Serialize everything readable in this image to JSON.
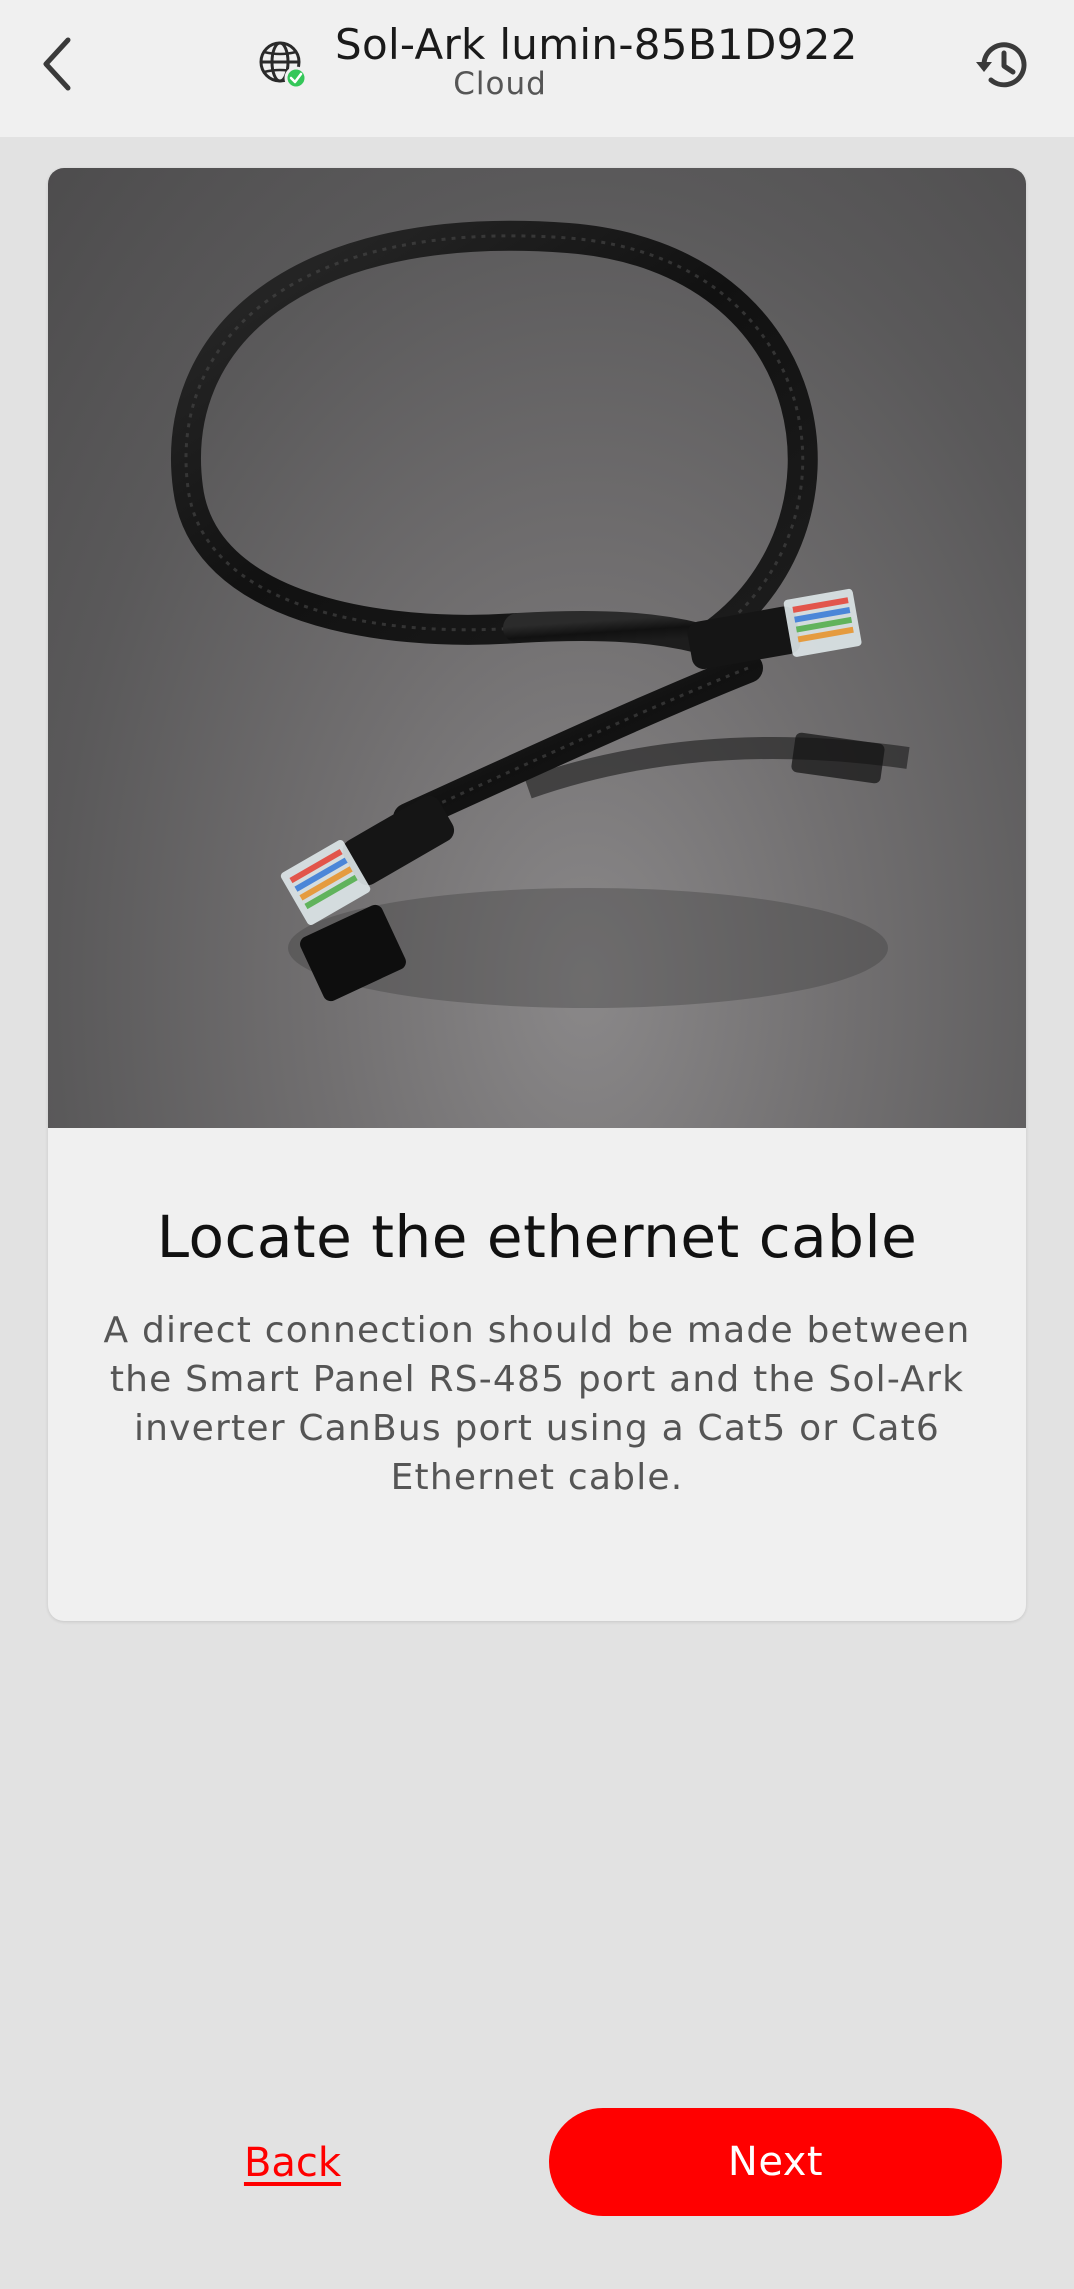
{
  "header": {
    "device_name": "Sol-Ark lumin-85B1D922",
    "connection_label": "Cloud",
    "icons": {
      "back": "chevron-left-icon",
      "connection": "globe-check-icon",
      "history": "history-icon"
    },
    "connection_status_color": "#34c759"
  },
  "card": {
    "image": "ethernet-cable-photo",
    "title": "Locate the ethernet cable",
    "description": "A direct connection should be made between the Smart Panel RS-485 port and the Sol-Ark inverter CanBus port using a Cat5 or Cat6 Ethernet cable."
  },
  "footer": {
    "back_label": "Back",
    "next_label": "Next"
  },
  "colors": {
    "accent": "#ff0000",
    "background": "#e2e2e2",
    "header_background": "#f0f0f0"
  }
}
